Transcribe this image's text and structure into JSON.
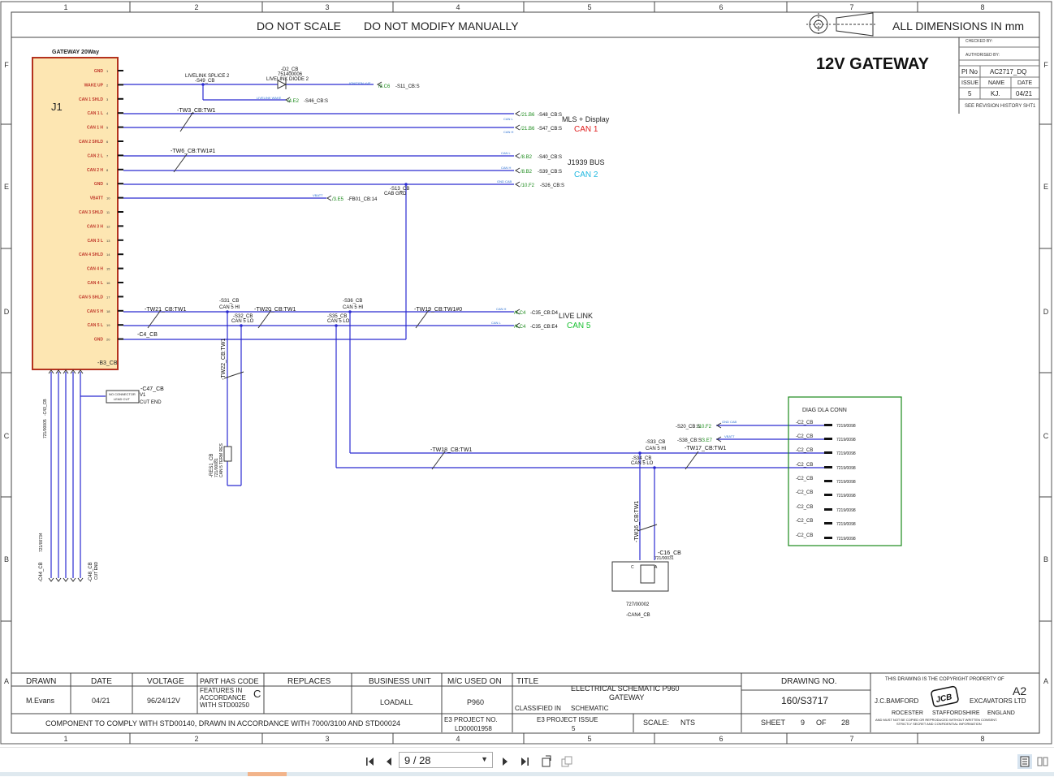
{
  "sheet": {
    "col_numbers": [
      "1",
      "2",
      "3",
      "4",
      "5",
      "6",
      "7",
      "8"
    ],
    "row_letters": [
      "F",
      "E",
      "D",
      "C",
      "B",
      "A"
    ],
    "header_left": "DO NOT SCALE",
    "header_mid": "DO NOT MODIFY MANUALLY",
    "header_right": "ALL DIMENSIONS IN mm",
    "title": "12V GATEWAY"
  },
  "revision_box": {
    "checked_by": "CHECKED BY:",
    "authorised_by": "AUTHORISED BY:",
    "pi_no_label": "PI No",
    "pi_no_value": "AC2717_DQ",
    "issue_label": "ISSUE",
    "name_label": "NAME",
    "date_label": "DATE",
    "issue_value": "5",
    "name_value": "KJ.",
    "date_value": "04/21",
    "history_note": "SEE REVISION HISTORY SHT1"
  },
  "connector_j1": {
    "title": "GATEWAY 20Way",
    "ref": "J1",
    "bottom_ref": "-B3_CB",
    "pins": [
      "GND",
      "WAKE UP",
      "CAN 1 SHLD",
      "CAN 1 L",
      "CAN 1 H",
      "CAN 2 SHLD",
      "CAN 2 L",
      "CAN 2 H",
      "GND",
      "VBATT",
      "CAN 3 SHLD",
      "CAN 3 H",
      "CAN 3 L",
      "CAN 4 SHLD",
      "CAN 4 H",
      "CAN 4 L",
      "CAN 5 SHLD",
      "CAN 5 H",
      "CAN 5 L",
      "GND"
    ],
    "pin_numbers": [
      "1",
      "2",
      "3",
      "4",
      "5",
      "6",
      "7",
      "8",
      "9",
      "10",
      "11",
      "12",
      "13",
      "14",
      "15",
      "16",
      "17",
      "18",
      "19",
      "20"
    ]
  },
  "labels": {
    "livelink_splice": "LIVELINK SPLICE 2",
    "s49": "-S49_CB",
    "d2": "-D2_CB",
    "d2_part": "751400006",
    "d2_name": "LIVELINK DIODE 2",
    "ignition": "IGNITION +VE",
    "ref_3c6": "/3.C6",
    "s11": "-S11_CB:S",
    "livelink_wake": "LIVELINK WAKE",
    "ref_4e2": "/4.E2",
    "s46": "-S46_CB:S",
    "tw3": "-TW3_CB:TW1",
    "can_l": "CAN L",
    "can_h": "CAN H",
    "ref_21b6a": "/21.B6",
    "s48": "-S48_CB:S",
    "ref_21b6b": "/21.B6",
    "s47": "-S47_CB:S",
    "mls_display": "MLS + Display",
    "can1": "CAN 1",
    "tw6": "-TW6_CB:TW1#1",
    "ref_8b2a": "/8.B2",
    "s40": "-S40_CB:S",
    "ref_8b2b": "/8.B2",
    "s39": "-S39_CB:S",
    "j1939": "J1939 BUS",
    "can2": "CAN 2",
    "gnd_cab": "GND CAB",
    "ref_10f2": "/10.F2",
    "s26": "-S26_CB:S",
    "vbatt": "VBATT",
    "ref_3e5": "/3.E5",
    "fb01": "-FB01_CB:14",
    "s13": "-S13_CB",
    "cab_grd": "CAB GRD",
    "tw21": "-TW21_CB:TW1",
    "s31": "-S31_CB",
    "can5hi_a": "CAN 5 HI",
    "tw20": "-TW20_CB:TW1",
    "s36": "-S36_CB",
    "can5hi_b": "CAN 5 HI",
    "s32": "-S32_CB",
    "can5lo_a": "CAN 5 LO",
    "s35": "-S35_CB",
    "can5lo_b": "CAN 5 LO",
    "tw19": "-TW19_CB:TW1#0",
    "ref_4c4a": "/4.C4",
    "c35a": "-C35_CB:D4",
    "ref_4c4b": "/4.C4",
    "c35b": "-C35_CB:E4",
    "live_link": "LIVE LINK",
    "can5": "CAN 5",
    "c4": "-C4_CB",
    "tw22": "-TW22_CB:TW1",
    "res1": "-RES1_CB",
    "res1_part": "721/00081",
    "res1_name": "CAN 5 TERM RES",
    "c47": "-C47_CB",
    "c47_v1": "V1",
    "no_connector": "NO CONNECTOR",
    "lead_cut": "LEAD CUT",
    "cut_end": "CUT END",
    "c43": "-C43_CB",
    "c43_part": "721/00005",
    "c44": "-C44_CB",
    "c44_part": "721/00734",
    "c48": "-C48_CB",
    "c48_end": "CUT END",
    "tw18": "-TW18_CB:TW1",
    "s33": "-S33_CB",
    "can5hi_c": "CAN 5 HI",
    "s34": "-S34_CB",
    "can5lo_c": "CAN 5 LO",
    "tw17": "-TW17_CB:TW1",
    "tw16": "-TW16_CB:TW1",
    "c16": "-C16_CB",
    "c16_part": "721/00031",
    "can4_part": "727/00002",
    "can4": "-CAN4_CB",
    "s20": "-S20_CB:S",
    "ref_10f2b": "/10.F2",
    "gnd_cab_b": "GND CAB",
    "s38": "-S38_CB:S",
    "ref_3e7": "/3.E7",
    "vbatt_b": "VBATT",
    "diag_title": "DIAG DLA CONN",
    "diag_ref": "-C2_CB",
    "diag_part": "7219/0098"
  },
  "title_block": {
    "drawn_label": "DRAWN",
    "drawn_value": "M.Evans",
    "date_label": "DATE",
    "date_value": "04/21",
    "voltage_label": "VOLTAGE",
    "voltage_value": "96/24/12V",
    "part_has_code": "PART HAS CODE",
    "features_line1": "FEATURES IN",
    "features_line2": "ACCORDANCE",
    "features_line3": "WITH STD00250",
    "code_letter": "C",
    "replaces_label": "REPLACES",
    "business_unit_label": "BUSINESS UNIT",
    "business_unit_value": "LOADALL",
    "mc_used_label": "M/C USED ON",
    "mc_used_value": "P960",
    "title_label": "TITLE",
    "title_line1": "ELECTRICAL SCHEMATIC P960",
    "title_line2": "GATEWAY",
    "classified_in": "CLASSIFIED IN",
    "classified_value": "SCHEMATIC",
    "drawing_no_label": "DRAWING NO.",
    "drawing_no_value": "160/S3717",
    "copyright": "THIS DRAWING IS THE COPYRIGHT PROPERTY OF",
    "size": "A2",
    "company1": "J.C.BAMFORD",
    "company2": "EXCAVATORS LTD",
    "addr1": "ROCESTER",
    "addr2": "STAFFORDSHIRE",
    "addr3": "ENGLAND",
    "legal": "AND MUST NOT BE COPIED OR REPRODUCED WITHOUT WRITTEN CONSENT.",
    "legal2": "STRICTLY SECRET AND CONFIDENTIAL INFORMATION",
    "logo_text": "JCB",
    "comply": "COMPONENT TO COMPLY WITH STD00140, DRAWN IN ACCORDANCE WITH 7000/3100 AND STD00024",
    "e3_project_label": "E3 PROJECT NO.",
    "e3_project_value": "LD00001958",
    "e3_issue_label": "E3 PROJECT ISSUE",
    "e3_issue_value": "5",
    "scale_label": "SCALE:",
    "scale_value": "NTS",
    "sheet_label": "SHEET",
    "sheet_value": "9",
    "of_label": "OF",
    "of_value": "28"
  },
  "toolbar": {
    "page_display": "9 / 28",
    "icons": [
      "first-page-icon",
      "prev-page-icon",
      "next-page-icon",
      "last-page-icon",
      "rotate-icon",
      "copy-icon",
      "single-page-icon",
      "two-page-icon"
    ]
  },
  "colors": {
    "wire": "#2b2bd1",
    "connector_fill": "#fde6b2",
    "connector_border": "#b4321e",
    "pin_label": "#c0392b",
    "ref_green": "#1a8a1a",
    "can1_red": "#e02020",
    "can2_cyan": "#20b8e0",
    "can5_green": "#18c030"
  }
}
